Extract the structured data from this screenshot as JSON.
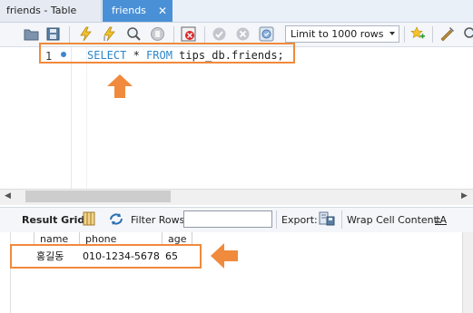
{
  "tabs": [
    {
      "label": "friends - Table",
      "active": false
    },
    {
      "label": "friends",
      "active": true,
      "close": "✕"
    }
  ],
  "toolbar": {
    "limit_select": "Limit to 1000 rows",
    "icons": [
      "open-folder-icon",
      "save-icon",
      "execute-icon",
      "execute-current-icon",
      "explain-icon",
      "stop-icon",
      "toggle-error-icon",
      "commit-icon",
      "rollback-icon",
      "autocommit-icon",
      "limit-rows-select",
      "bookmark-star-icon",
      "beautify-icon"
    ]
  },
  "editor": {
    "line_number": "1",
    "code": {
      "kw1": "SELECT",
      "star": " * ",
      "kw2": "FROM",
      "rest": " tips_db.friends;"
    }
  },
  "result_toolbar": {
    "result_grid": "Result Grid",
    "filter_rows": "Filter Rows:",
    "filter_value": "",
    "export": "Export:",
    "wrap": "Wrap Cell Content:",
    "wrap_icon_glyph": "‡A"
  },
  "grid": {
    "columns": [
      "name",
      "phone",
      "age"
    ],
    "rows": [
      [
        "홍길동",
        "010-1234-5678",
        "65"
      ]
    ]
  },
  "colors": {
    "highlight": "#f08a3c",
    "active_tab": "#4a90d6",
    "keyword": "#2f86c8"
  }
}
